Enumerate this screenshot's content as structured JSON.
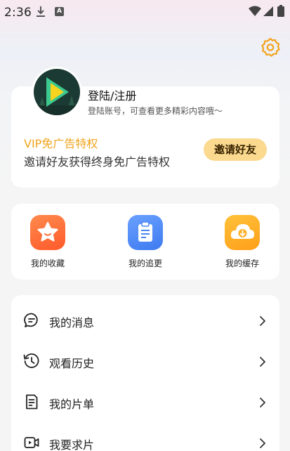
{
  "status_bar": {
    "time": "2:36",
    "icons": [
      "download-icon",
      "a-notification-icon",
      "wifi-icon",
      "signal-icon",
      "battery-icon"
    ],
    "a_badge": "A"
  },
  "header": {
    "settings_icon": "gear-icon"
  },
  "profile": {
    "avatar_icon": "app-logo-play-icon",
    "login_title": "登陆/注册",
    "login_subtitle": "登陆账号，可查看更多精彩内容哦～",
    "vip_title": "VIP免广告特权",
    "vip_desc": "邀请好友获得终身免广告特权",
    "invite_button": "邀请好友"
  },
  "quick_actions": [
    {
      "label": "我的收藏",
      "icon": "star-icon"
    },
    {
      "label": "我的追更",
      "icon": "clipboard-icon"
    },
    {
      "label": "我的缓存",
      "icon": "cloud-download-icon"
    }
  ],
  "menu": [
    {
      "label": "我的消息",
      "icon": "message-icon"
    },
    {
      "label": "观看历史",
      "icon": "history-icon"
    },
    {
      "label": "我的片单",
      "icon": "document-list-icon"
    },
    {
      "label": "我要求片",
      "icon": "video-request-icon"
    }
  ],
  "colors": {
    "accent_gold": "#f0a41e",
    "invite_button_bg": "#fbd98f",
    "favorite_orange": "#ff6a35",
    "follow_blue": "#4a86f5",
    "cache_yellow": "#ffae22"
  }
}
